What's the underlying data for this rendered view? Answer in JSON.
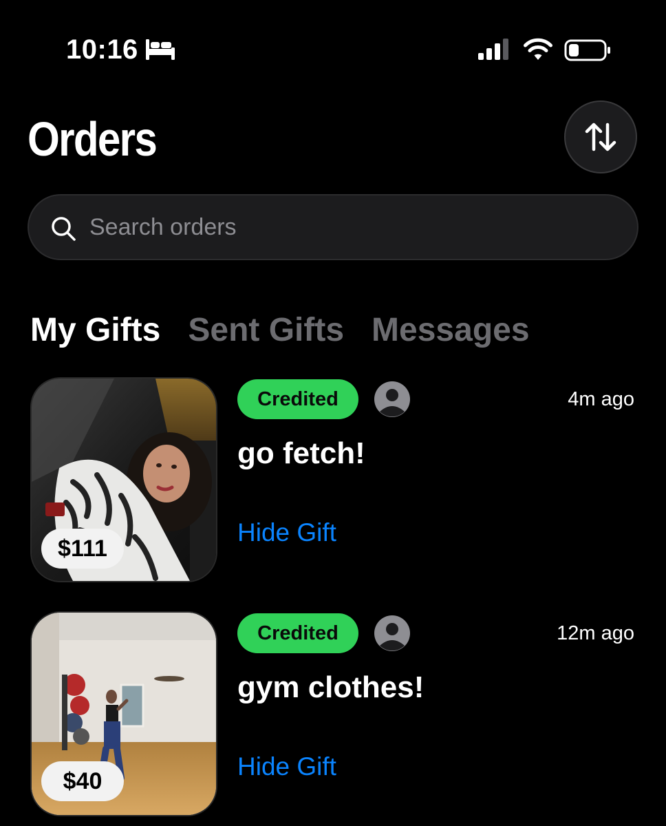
{
  "status_bar": {
    "time": "10:16",
    "icons": [
      "bed-icon",
      "cellular-signal-icon",
      "wifi-icon",
      "battery-icon"
    ]
  },
  "header": {
    "title": "Orders",
    "sort_icon": "sort-arrows-icon"
  },
  "search": {
    "placeholder": "Search orders",
    "value": "",
    "icon": "search-icon"
  },
  "tabs": [
    {
      "label": "My Gifts",
      "active": true
    },
    {
      "label": "Sent Gifts",
      "active": false
    },
    {
      "label": "Messages",
      "active": false
    }
  ],
  "orders": [
    {
      "price": "$111",
      "status": "Credited",
      "time": "4m ago",
      "title": "go fetch!",
      "action": "Hide Gift"
    },
    {
      "price": "$40",
      "status": "Credited",
      "time": "12m ago",
      "title": "gym clothes!",
      "action": "Hide Gift"
    }
  ],
  "colors": {
    "background": "#000000",
    "accent_link": "#0a84ff",
    "status_green": "#30d158",
    "inactive_tab": "#6c6c70"
  }
}
